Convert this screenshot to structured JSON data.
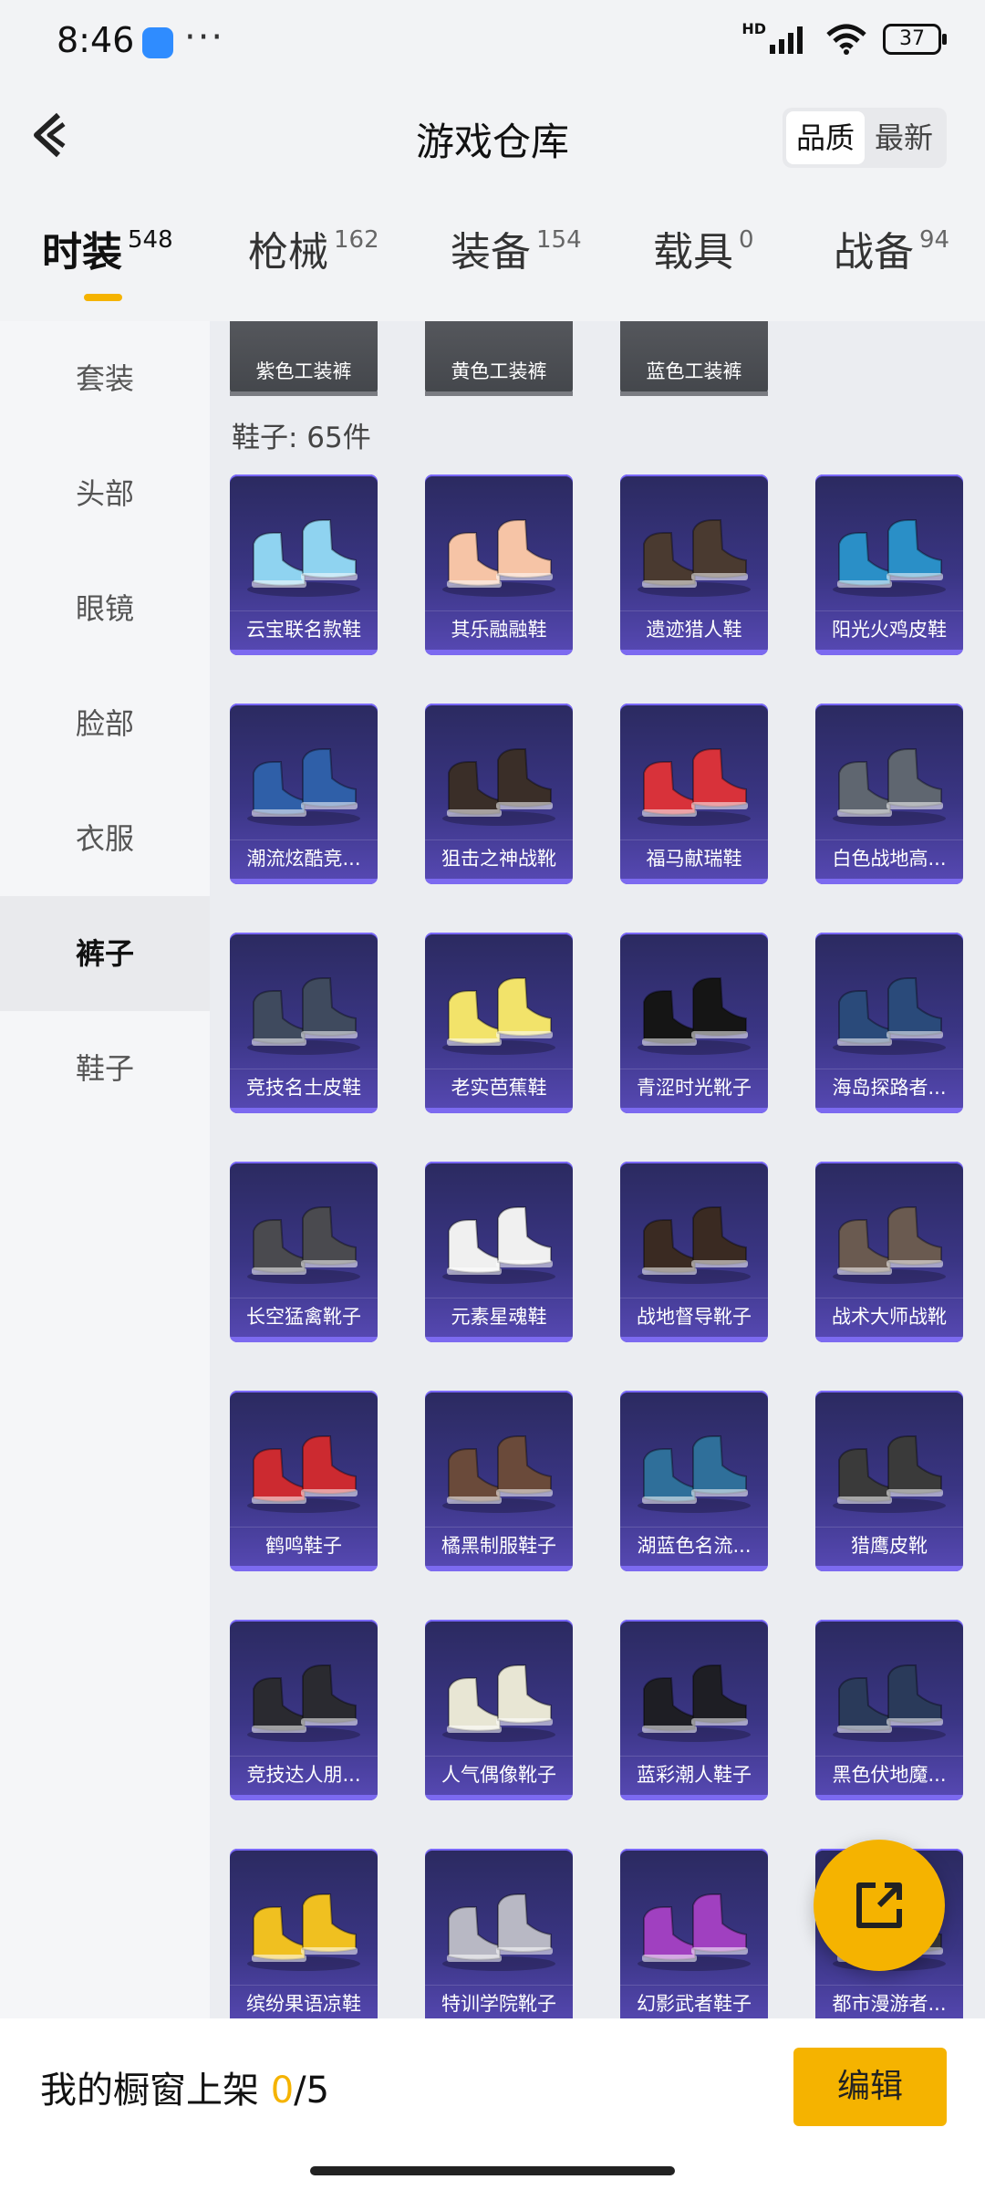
{
  "status_bar": {
    "time": "8:46",
    "battery": "37",
    "network_badge": "HD",
    "icons": [
      "app-icon",
      "more-icon",
      "signal-icon",
      "wifi-icon",
      "battery-icon"
    ]
  },
  "header": {
    "title": "游戏仓库",
    "sort_options": [
      "品质",
      "最新"
    ],
    "sort_active": "品质"
  },
  "tabs": [
    {
      "label": "时装",
      "count": "548",
      "active": true
    },
    {
      "label": "枪械",
      "count": "162"
    },
    {
      "label": "装备",
      "count": "154"
    },
    {
      "label": "载具",
      "count": "0"
    },
    {
      "label": "战备",
      "count": "94"
    }
  ],
  "sidebar": {
    "items": [
      "套装",
      "头部",
      "眼镜",
      "脸部",
      "衣服",
      "裤子",
      "鞋子"
    ],
    "active": "裤子"
  },
  "pants_row": [
    "紫色工装裤",
    "黄色工装裤",
    "蓝色工装裤"
  ],
  "section": {
    "label": "鞋子: 65件"
  },
  "shoes": [
    "云宝联名款鞋",
    "其乐融融鞋",
    "遗迹猎人鞋",
    "阳光火鸡皮鞋",
    "潮流炫酷竞...",
    "狙击之神战靴",
    "福马献瑞鞋",
    "白色战地高...",
    "竞技名士皮鞋",
    "老实芭蕉鞋",
    "青涩时光靴子",
    "海岛探路者...",
    "长空猛禽靴子",
    "元素星魂鞋",
    "战地督导靴子",
    "战术大师战靴",
    "鹤鸣鞋子",
    "橘黑制服鞋子",
    "湖蓝色名流...",
    "猎鹰皮靴",
    "竞技达人朋...",
    "人气偶像靴子",
    "蓝彩潮人鞋子",
    "黑色伏地魔...",
    "缤纷果语凉鞋",
    "特训学院靴子",
    "幻影武者鞋子",
    "都市漫游者..."
  ],
  "shoe_colors": [
    "#8fd3f0",
    "#f6c4a6",
    "#4a3a30",
    "#2a8fc7",
    "#2f5fa8",
    "#3a2e28",
    "#d8323a",
    "#5f6670",
    "#3f4a5e",
    "#f2e36a",
    "#151515",
    "#2a4a7a",
    "#4a4a4f",
    "#f0f0f0",
    "#3a2a22",
    "#6a5a50",
    "#cc2a30",
    "#6a4a3a",
    "#2f6f9a",
    "#3a3a3a",
    "#2a2a30",
    "#e8e6d4",
    "#1e1e24",
    "#2a3a5a",
    "#f0c020",
    "#b8b8c4",
    "#a040c0",
    "#3a3a40"
  ],
  "bottom": {
    "shelf_label": "我的橱窗上架",
    "shelf_used": "0",
    "shelf_total": "/5",
    "edit_label": "编辑"
  },
  "accent": "#f5b300"
}
